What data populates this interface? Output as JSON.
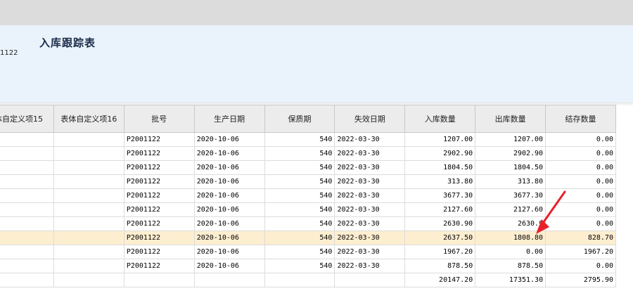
{
  "report": {
    "title": "入库跟踪表",
    "subtitle": "1122"
  },
  "columns": [
    "体自定义项15",
    "表体自定义项16",
    "批号",
    "生产日期",
    "保质期",
    "失效日期",
    "入库数量",
    "出库数量",
    "结存数量"
  ],
  "rows": [
    {
      "batch": "P2001122",
      "prod_date": "2020-10-06",
      "shelf": "540",
      "exp_date": "2022-03-30",
      "in_qty": "1207.00",
      "out_qty": "1207.00",
      "bal_qty": "0.00"
    },
    {
      "batch": "P2001122",
      "prod_date": "2020-10-06",
      "shelf": "540",
      "exp_date": "2022-03-30",
      "in_qty": "2902.90",
      "out_qty": "2902.90",
      "bal_qty": "0.00"
    },
    {
      "batch": "P2001122",
      "prod_date": "2020-10-06",
      "shelf": "540",
      "exp_date": "2022-03-30",
      "in_qty": "1804.50",
      "out_qty": "1804.50",
      "bal_qty": "0.00"
    },
    {
      "batch": "P2001122",
      "prod_date": "2020-10-06",
      "shelf": "540",
      "exp_date": "2022-03-30",
      "in_qty": "313.80",
      "out_qty": "313.80",
      "bal_qty": "0.00"
    },
    {
      "batch": "P2001122",
      "prod_date": "2020-10-06",
      "shelf": "540",
      "exp_date": "2022-03-30",
      "in_qty": "3677.30",
      "out_qty": "3677.30",
      "bal_qty": "0.00"
    },
    {
      "batch": "P2001122",
      "prod_date": "2020-10-06",
      "shelf": "540",
      "exp_date": "2022-03-30",
      "in_qty": "2127.60",
      "out_qty": "2127.60",
      "bal_qty": "0.00"
    },
    {
      "batch": "P2001122",
      "prod_date": "2020-10-06",
      "shelf": "540",
      "exp_date": "2022-03-30",
      "in_qty": "2630.90",
      "out_qty": "2630.9",
      "bal_qty": "0.00"
    },
    {
      "batch": "P2001122",
      "prod_date": "2020-10-06",
      "shelf": "540",
      "exp_date": "2022-03-30",
      "in_qty": "2637.50",
      "out_qty": "1808.80",
      "bal_qty": "828.70"
    },
    {
      "batch": "P2001122",
      "prod_date": "2020-10-06",
      "shelf": "540",
      "exp_date": "2022-03-30",
      "in_qty": "1967.20",
      "out_qty": "0.00",
      "bal_qty": "1967.20"
    },
    {
      "batch": "P2001122",
      "prod_date": "2020-10-06",
      "shelf": "540",
      "exp_date": "2022-03-30",
      "in_qty": "878.50",
      "out_qty": "878.50",
      "bal_qty": "0.00"
    }
  ],
  "selected_row": 7,
  "totals": {
    "in_qty": "20147.20",
    "out_qty": "17351.30",
    "bal_qty": "2795.90"
  },
  "colors": {
    "selected_row": "#fdeed0",
    "header_bg": "#ececec",
    "title_panel": "#eaf3fb",
    "arrow": "#e8202a"
  }
}
